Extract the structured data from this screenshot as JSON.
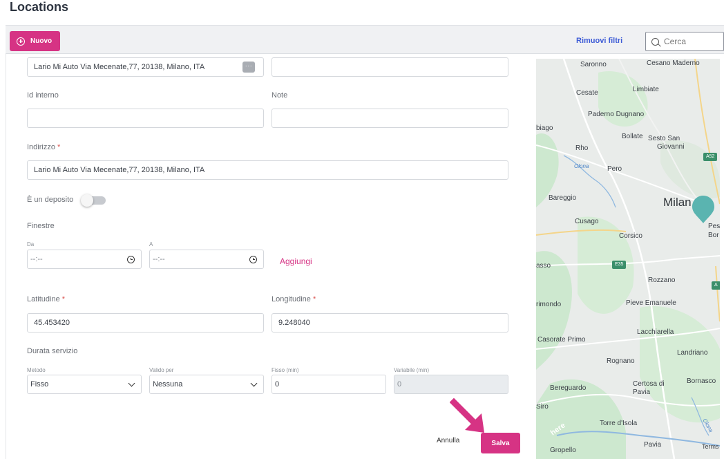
{
  "page": {
    "title": "Locations"
  },
  "toolbar": {
    "new_label": "Nuovo",
    "remove_filters_label": "Rimuovi filtri",
    "search_placeholder": "Cerca"
  },
  "form": {
    "name_value": "Lario Mi Auto Via Mecenate,77, 20138, Milano, ITA",
    "name_button_label": "···",
    "second_top_value": "",
    "internal_id_label": "Id interno",
    "internal_id_value": "",
    "notes_label": "Note",
    "notes_value": "",
    "address_label": "Indirizzo",
    "address_value": "Lario Mi Auto Via Mecenate,77, 20138, Milano, ITA",
    "required_mark": "*",
    "depot_label": "È un deposito",
    "depot_enabled": false,
    "windows_label": "Finestre",
    "from_label": "Da",
    "from_value": "--:--",
    "to_label": "A",
    "to_value": "--:--",
    "add_label": "Aggiungi",
    "latitude_label": "Latitudine",
    "latitude_value": "45.453420",
    "longitude_label": "Longitudine",
    "longitude_value": "9.248040",
    "service_duration_label": "Durata servizio",
    "method_label": "Metodo",
    "method_value": "Fisso",
    "valid_for_label": "Valido per",
    "valid_for_value": "Nessuna",
    "fixed_label": "Fisso (min)",
    "fixed_value": "0",
    "variable_label": "Variabile (min)",
    "variable_value": "0",
    "cancel_label": "Annulla",
    "save_label": "Salva"
  },
  "map": {
    "places": {
      "saronno": "Saronno",
      "cesano": "Cesano Maderno",
      "cesate": "Cesate",
      "limbiate": "Limbiate",
      "paderno": "Paderno Dugnano",
      "biago": "biago",
      "bollate": "Bollate",
      "sesto": "Sesto San",
      "giovanni": "Giovanni",
      "rho": "Rho",
      "olona": "Olona",
      "pero": "Pero",
      "bareggio": "Bareggio",
      "milano": "Milan",
      "cusago": "Cusago",
      "pes": "Pes",
      "bor": "Bor",
      "corsico": "Corsico",
      "asso": "asso",
      "rozzano": "Rozzano",
      "rimondo": "rimondo",
      "pieve": "Pieve Emanuele",
      "lacchiarella": "Lacchiarella",
      "casorate": "Casorate Primo",
      "landriano": "Landriano",
      "rognano": "Rognano",
      "bornasco": "Bornasco",
      "bereguardo": "Bereguardo",
      "certosa": "Certosa di",
      "certosa2": "Pavia",
      "siro": "Siro",
      "torre": "Torre d'Isola",
      "pavia": "Pavia",
      "gropello": "Gropello",
      "terms": "Terms",
      "here": "here",
      "olona2": "Olona"
    },
    "shields": {
      "a52": "A52",
      "e35": "E35",
      "a": "A"
    },
    "water_color": "#8fb8e0",
    "land_color": "#e9ecea",
    "green_color": "#cde8cf",
    "pin_color": "#5ab4b0"
  },
  "colors": {
    "accent": "#d63384",
    "link": "#3d5bd6"
  }
}
